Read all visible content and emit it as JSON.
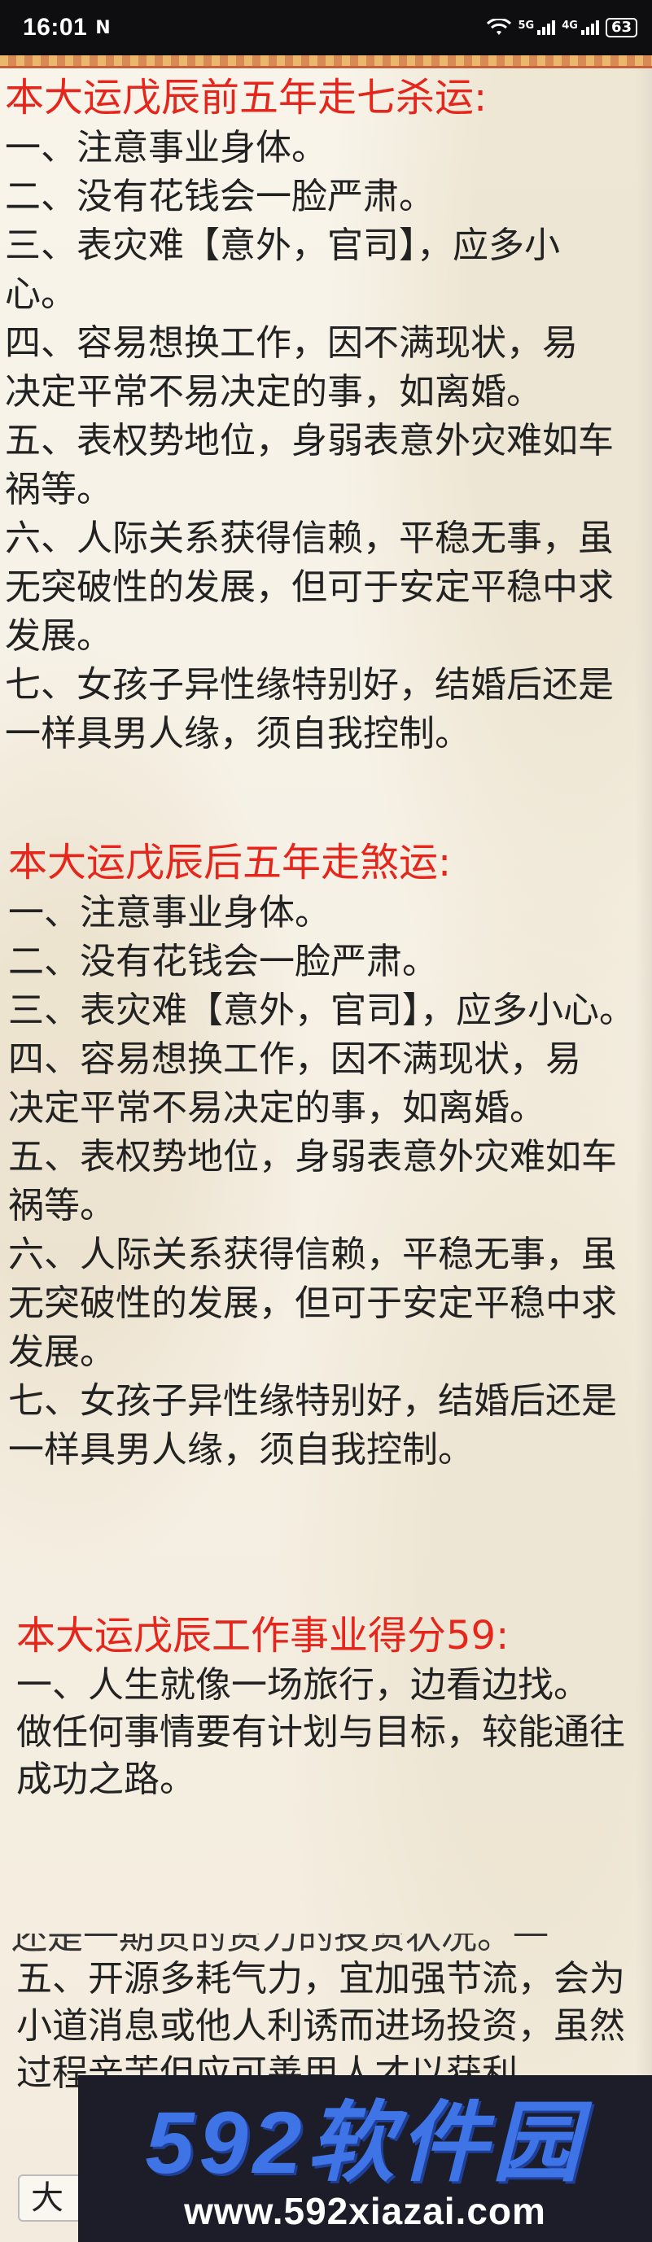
{
  "status_bar": {
    "time": "16:01",
    "nfc": "N",
    "signal1_label": "5G",
    "signal2_label": "4G",
    "battery": "63",
    "icons": [
      "wifi-icon",
      "signal-icon",
      "signal-icon",
      "battery-icon"
    ]
  },
  "sections": [
    {
      "heading": "本大运戊辰前五年走七杀运:",
      "items": [
        "一、注意事业身体。",
        "二、没有花钱会一脸严肃。",
        "三、表灾难【意外，官司】，应多小心。",
        "四、容易想换工作，因不满现状，易决定平常不易决定的事，如离婚。",
        "五、表权势地位，身弱表意外灾难如车祸等。",
        "六、人际关系获得信赖，平稳无事，虽无突破性的发展，但可于安定平稳中求发展。",
        "七、女孩子异性缘特别好，结婚后还是一样具男人缘，须自我控制。"
      ]
    },
    {
      "heading": "本大运戊辰后五年走煞运:",
      "items": [
        "一、注意事业身体。",
        "二、没有花钱会一脸严肃。",
        "三、表灾难【意外，官司】，应多小心。",
        "四、容易想换工作，因不满现状，易决定平常不易决定的事，如离婚。",
        "五、表权势地位，身弱表意外灾难如车祸等。",
        "六、人际关系获得信赖，平稳无事，虽无突破性的发展，但可于安定平稳中求发展。",
        "七、女孩子异性缘特别好，结婚后还是一样具男人缘，须自我控制。"
      ]
    },
    {
      "heading": "本大运戊辰工作事业得分59:",
      "items": [
        "一、人生就像一场旅行，边看边找。",
        "做任何事情要有计划与目标，较能通往成功之路。"
      ]
    }
  ],
  "truncated_line": "还是一期货的资力的投资状况。一",
  "section4_items": [
    "五、开源多耗气力，宜加强节流，会为小道消息或他人利诱而进场投资，虽然过程辛苦但应可善用人才以获利。"
  ],
  "watermark": {
    "logo": "592软件园",
    "url": "www.592xiazai.com"
  },
  "bottom_button": "大"
}
